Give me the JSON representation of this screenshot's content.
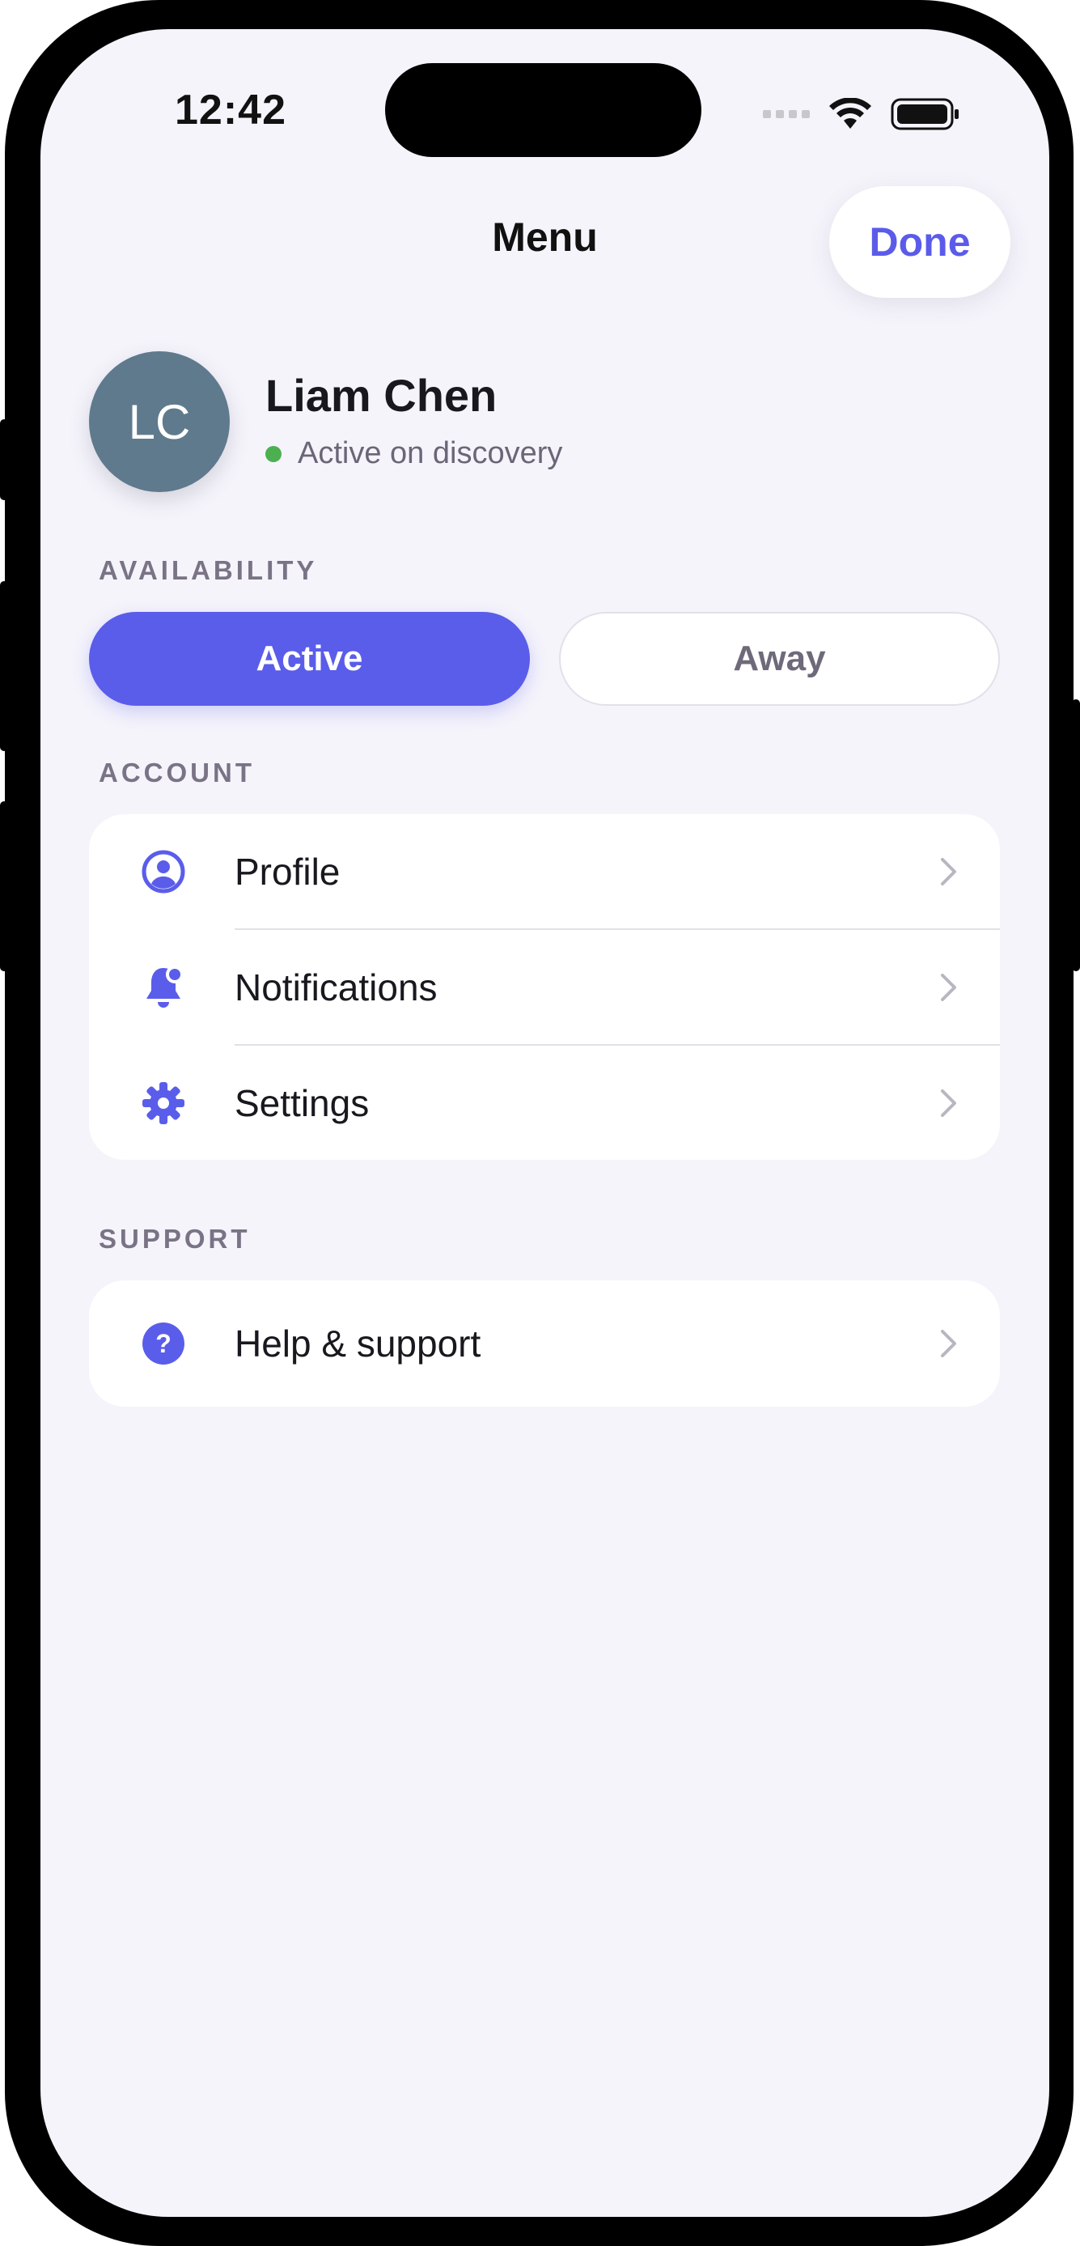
{
  "status_bar": {
    "time": "12:42"
  },
  "header": {
    "title": "Menu",
    "done_label": "Done"
  },
  "user": {
    "initials": "LC",
    "name": "Liam Chen",
    "status": "Active on discovery",
    "status_color": "#4cb050"
  },
  "availability": {
    "section_label": "AVAILABILITY",
    "options": [
      "Active",
      "Away"
    ],
    "selected": "Active"
  },
  "account": {
    "section_label": "ACCOUNT",
    "items": [
      {
        "label": "Profile",
        "icon": "profile-icon"
      },
      {
        "label": "Notifications",
        "icon": "bell-icon"
      },
      {
        "label": "Settings",
        "icon": "gear-icon"
      }
    ]
  },
  "support": {
    "section_label": "SUPPORT",
    "items": [
      {
        "label": "Help & support",
        "icon": "help-icon"
      }
    ]
  },
  "colors": {
    "accent": "#5a5dea",
    "background": "#f5f4fb",
    "avatar": "#5f7a8d"
  }
}
